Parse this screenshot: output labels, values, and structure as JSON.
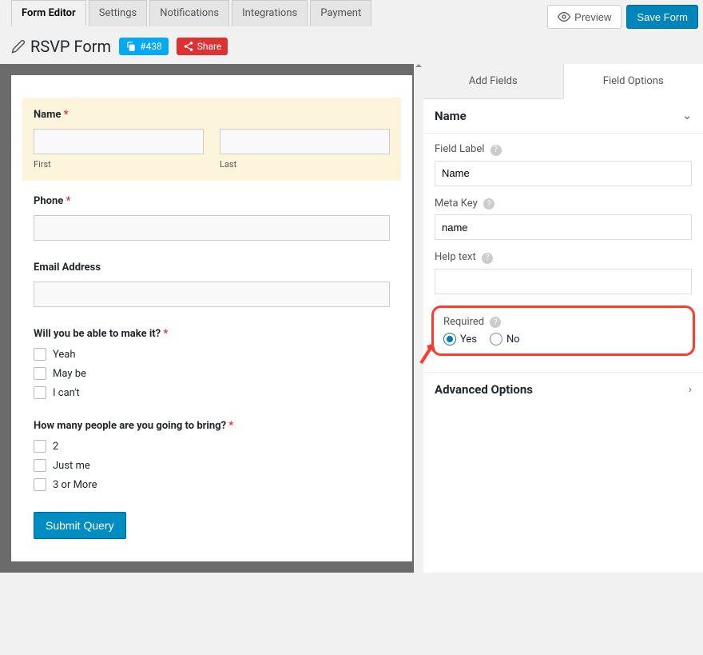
{
  "tabs": {
    "form_editor": "Form Editor",
    "settings": "Settings",
    "notifications": "Notifications",
    "integrations": "Integrations",
    "payment": "Payment"
  },
  "actions": {
    "preview": "Preview",
    "save": "Save Form"
  },
  "header": {
    "title": "RSVP Form",
    "badge": "#438",
    "share": "Share"
  },
  "form": {
    "name": {
      "label": "Name",
      "first": "First",
      "last": "Last"
    },
    "phone": {
      "label": "Phone"
    },
    "email": {
      "label": "Email Address"
    },
    "attend": {
      "label": "Will you be able to make it?",
      "opts": [
        "Yeah",
        "May be",
        "I can't"
      ]
    },
    "guests": {
      "label": "How many people are you going to bring?",
      "opts": [
        "2",
        "Just me",
        "3 or More"
      ]
    },
    "submit": "Submit Query"
  },
  "side": {
    "tabs": {
      "add": "Add Fields",
      "options": "Field Options"
    },
    "panel_title": "Name",
    "field_label": {
      "lab": "Field Label",
      "val": "Name"
    },
    "meta_key": {
      "lab": "Meta Key",
      "val": "name"
    },
    "help_text": {
      "lab": "Help text",
      "val": ""
    },
    "required": {
      "lab": "Required",
      "yes": "Yes",
      "no": "No"
    },
    "advanced": "Advanced Options"
  }
}
